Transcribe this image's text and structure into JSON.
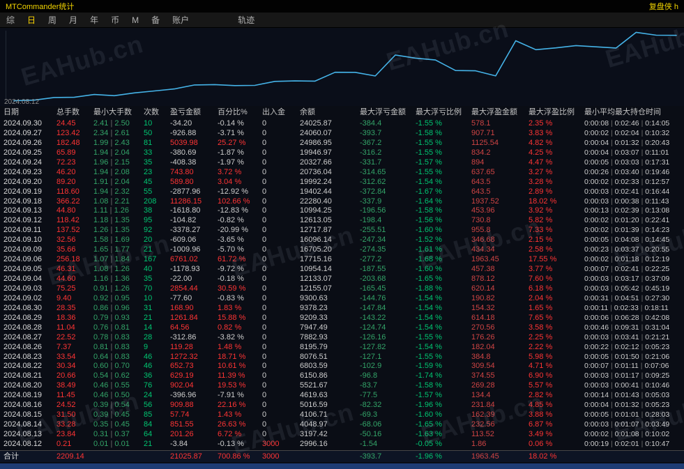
{
  "title_bar": {
    "app_title": "MTCommander统计",
    "right_text": "复盘侠 h"
  },
  "menu": {
    "items": [
      "综",
      "日",
      "周",
      "月",
      "年",
      "币",
      "M",
      "备",
      "账户",
      "轨迹"
    ],
    "active": "日"
  },
  "chart": {
    "label_start_date": "2024.08.12",
    "watermark": "EAHub.cn",
    "line_color": "#45b3e8"
  },
  "chart_data": {
    "type": "line",
    "title": "",
    "xlabel": "",
    "ylabel": "余额",
    "legend": [],
    "grid": false,
    "ylim": [
      2900,
      25300
    ],
    "x": [
      "2024.08.12",
      "2024.08.13",
      "2024.08.14",
      "2024.08.15",
      "2024.08.16",
      "2024.08.19",
      "2024.08.20",
      "2024.08.21",
      "2024.08.22",
      "2024.08.23",
      "2024.08.26",
      "2024.08.27",
      "2024.08.28",
      "2024.08.29",
      "2024.08.30",
      "2024.09.02",
      "2024.09.03",
      "2024.09.04",
      "2024.09.05",
      "2024.09.06",
      "2024.09.09",
      "2024.09.10",
      "2024.09.11",
      "2024.09.12",
      "2024.09.13",
      "2024.09.18",
      "2024.09.19",
      "2024.09.20",
      "2024.09.23",
      "2024.09.24",
      "2024.09.25",
      "2024.09.26",
      "2024.09.27",
      "2024.09.30"
    ],
    "series": [
      {
        "name": "余额",
        "values": [
          2996.16,
          3197.42,
          4048.97,
          4106.71,
          5016.59,
          4619.63,
          5521.67,
          6150.86,
          6803.59,
          8076.51,
          8195.79,
          7882.93,
          7947.49,
          9209.33,
          9378.23,
          9300.63,
          12155.07,
          12133.07,
          10954.14,
          17715.16,
          16705.2,
          16096.14,
          12717.87,
          12613.05,
          10994.25,
          22280.4,
          19402.44,
          19992.24,
          20736.04,
          20327.66,
          19946.97,
          24986.95,
          24060.07,
          24025.87
        ]
      }
    ]
  },
  "table": {
    "headers": [
      "日期",
      "总手数",
      "最小大手数",
      "次数",
      "盈亏金额",
      "百分比%",
      "出入金",
      "余额",
      "最大浮亏金额",
      "最大浮亏比例",
      "最大浮盈金额",
      "最大浮盈比例",
      "最小平均最大持仓时间"
    ],
    "rows": [
      {
        "d": "2024.09.30",
        "lots": "24.45",
        "mn": "2.41",
        "mx": "2.50",
        "n": "10",
        "pl": "-34.20",
        "plp": "-0.14 %",
        "io": "0",
        "bal": "24025.87",
        "mfl": "-384.4",
        "mflp": "-1.55 %",
        "mfp": "578.1",
        "mfpp": "2.35 %",
        "t": [
          "0:00:08",
          "0:02:46",
          "0:14:05"
        ]
      },
      {
        "d": "2024.09.27",
        "lots": "123.42",
        "mn": "2.34",
        "mx": "2.61",
        "n": "50",
        "pl": "-926.88",
        "plp": "-3.71 %",
        "io": "0",
        "bal": "24060.07",
        "mfl": "-393.7",
        "mflp": "-1.58 %",
        "mfp": "907.71",
        "mfpp": "3.83 %",
        "t": [
          "0:00:02",
          "0:02:04",
          "0:10:32"
        ]
      },
      {
        "d": "2024.09.26",
        "lots": "182.48",
        "mn": "1.99",
        "mx": "2.43",
        "n": "81",
        "pl": "5039.98",
        "plp": "25.27 %",
        "io": "0",
        "bal": "24986.95",
        "mfl": "-367.2",
        "mflp": "-1.55 %",
        "mfp": "1125.54",
        "mfpp": "4.82 %",
        "t": [
          "0:00:04",
          "0:01:32",
          "0:20:43"
        ]
      },
      {
        "d": "2024.09.25",
        "lots": "65.89",
        "mn": "1.94",
        "mx": "2.04",
        "n": "33",
        "pl": "-380.69",
        "plp": "-1.87 %",
        "io": "0",
        "bal": "19946.97",
        "mfl": "-316.2",
        "mflp": "-1.55 %",
        "mfp": "834.2",
        "mfpp": "4.25 %",
        "t": [
          "0:00:04",
          "0:03:07",
          "0:11:01"
        ]
      },
      {
        "d": "2024.09.24",
        "lots": "72.23",
        "mn": "1.96",
        "mx": "2.15",
        "n": "35",
        "pl": "-408.38",
        "plp": "-1.97 %",
        "io": "0",
        "bal": "20327.66",
        "mfl": "-331.7",
        "mflp": "-1.57 %",
        "mfp": "894",
        "mfpp": "4.47 %",
        "t": [
          "0:00:05",
          "0:03:03",
          "0:17:31"
        ]
      },
      {
        "d": "2024.09.23",
        "lots": "46.20",
        "mn": "1.94",
        "mx": "2.08",
        "n": "23",
        "pl": "743.80",
        "plp": "3.72 %",
        "io": "0",
        "bal": "20736.04",
        "mfl": "-314.65",
        "mflp": "-1.55 %",
        "mfp": "637.65",
        "mfpp": "3.27 %",
        "t": [
          "0:00:26",
          "0:03:40",
          "0:19:46"
        ]
      },
      {
        "d": "2024.09.20",
        "lots": "89.20",
        "mn": "1.91",
        "mx": "2.04",
        "n": "45",
        "pl": "589.80",
        "plp": "3.04 %",
        "io": "0",
        "bal": "19992.24",
        "mfl": "-312.62",
        "mflp": "-1.54 %",
        "mfp": "643.5",
        "mfpp": "3.28 %",
        "t": [
          "0:00:02",
          "0:02:33",
          "0:12:57"
        ]
      },
      {
        "d": "2024.09.19",
        "lots": "118.60",
        "mn": "1.94",
        "mx": "2.32",
        "n": "55",
        "pl": "-2877.96",
        "plp": "-12.92 %",
        "io": "0",
        "bal": "19402.44",
        "mfl": "-372.84",
        "mflp": "-1.67 %",
        "mfp": "643.5",
        "mfpp": "2.89 %",
        "t": [
          "0:00:03",
          "0:02:41",
          "0:16:44"
        ]
      },
      {
        "d": "2024.09.18",
        "lots": "366.22",
        "mn": "1.08",
        "mx": "2.21",
        "n": "208",
        "pl": "11286.15",
        "plp": "102.66 %",
        "io": "0",
        "bal": "22280.40",
        "mfl": "-337.9",
        "mflp": "-1.64 %",
        "mfp": "1937.52",
        "mfpp": "18.02 %",
        "t": [
          "0:00:03",
          "0:00:38",
          "0:11:43"
        ]
      },
      {
        "d": "2024.09.13",
        "lots": "44.80",
        "mn": "1.11",
        "mx": "1.26",
        "n": "38",
        "pl": "-1618.80",
        "plp": "-12.83 %",
        "io": "0",
        "bal": "10994.25",
        "mfl": "-196.56",
        "mflp": "-1.58 %",
        "mfp": "453.96",
        "mfpp": "3.92 %",
        "t": [
          "0:00:13",
          "0:02:39",
          "0:13:08"
        ]
      },
      {
        "d": "2024.09.12",
        "lots": "118.42",
        "mn": "1.18",
        "mx": "1.35",
        "n": "95",
        "pl": "-104.82",
        "plp": "-0.82 %",
        "io": "0",
        "bal": "12613.05",
        "mfl": "-198.4",
        "mflp": "-1.56 %",
        "mfp": "730.8",
        "mfpp": "5.82 %",
        "t": [
          "0:00:02",
          "0:01:20",
          "0:22:41"
        ]
      },
      {
        "d": "2024.09.11",
        "lots": "137.52",
        "mn": "1.26",
        "mx": "1.35",
        "n": "92",
        "pl": "-3378.27",
        "plp": "-20.99 %",
        "io": "0",
        "bal": "12717.87",
        "mfl": "-255.51",
        "mflp": "-1.60 %",
        "mfp": "955.8",
        "mfpp": "7.33 %",
        "t": [
          "0:00:02",
          "0:01:39",
          "0:14:23"
        ]
      },
      {
        "d": "2024.09.10",
        "lots": "32.56",
        "mn": "1.58",
        "mx": "1.69",
        "n": "20",
        "pl": "-609.06",
        "plp": "-3.65 %",
        "io": "0",
        "bal": "16096.14",
        "mfl": "-247.34",
        "mflp": "-1.52 %",
        "mfp": "346.68",
        "mfpp": "2.15 %",
        "t": [
          "0:00:05",
          "0:04:08",
          "0:14:45"
        ]
      },
      {
        "d": "2024.09.09",
        "lots": "35.66",
        "mn": "1.65",
        "mx": "1.77",
        "n": "21",
        "pl": "-1009.96",
        "plp": "-5.70 %",
        "io": "0",
        "bal": "16705.20",
        "mfl": "-274.35",
        "mflp": "-1.61 %",
        "mfp": "434.34",
        "mfpp": "2.58 %",
        "t": [
          "0:00:23",
          "0:03:37",
          "0:20:55"
        ]
      },
      {
        "d": "2024.09.06",
        "lots": "256.18",
        "mn": "1.07",
        "mx": "1.84",
        "n": "167",
        "pl": "6761.02",
        "plp": "61.72 %",
        "io": "0",
        "bal": "17715.16",
        "mfl": "-277.2",
        "mflp": "-1.68 %",
        "mfp": "1963.45",
        "mfpp": "17.55 %",
        "t": [
          "0:00:02",
          "0:01:18",
          "0:12:19"
        ]
      },
      {
        "d": "2024.09.05",
        "lots": "46.31",
        "mn": "1.08",
        "mx": "1.26",
        "n": "40",
        "pl": "-1178.93",
        "plp": "-9.72 %",
        "io": "0",
        "bal": "10954.14",
        "mfl": "-187.55",
        "mflp": "-1.60 %",
        "mfp": "457.38",
        "mfpp": "3.77 %",
        "t": [
          "0:00:07",
          "0:02:41",
          "0:22:25"
        ]
      },
      {
        "d": "2024.09.04",
        "lots": "44.60",
        "mn": "1.16",
        "mx": "1.36",
        "n": "35",
        "pl": "-22.00",
        "plp": "-0.18 %",
        "io": "0",
        "bal": "12133.07",
        "mfl": "-203.68",
        "mflp": "-1.65 %",
        "mfp": "878.12",
        "mfpp": "7.60 %",
        "t": [
          "0:00:03",
          "0:03:17",
          "0:37:09"
        ]
      },
      {
        "d": "2024.09.03",
        "lots": "75.25",
        "mn": "0.91",
        "mx": "1.26",
        "n": "70",
        "pl": "2854.44",
        "plp": "30.59 %",
        "io": "0",
        "bal": "12155.07",
        "mfl": "-165.45",
        "mflp": "-1.88 %",
        "mfp": "620.14",
        "mfpp": "6.18 %",
        "t": [
          "0:00:03",
          "0:05:42",
          "0:45:19"
        ]
      },
      {
        "d": "2024.09.02",
        "lots": "9.40",
        "mn": "0.92",
        "mx": "0.95",
        "n": "10",
        "pl": "-77.60",
        "plp": "-0.83 %",
        "io": "0",
        "bal": "9300.63",
        "mfl": "-144.76",
        "mflp": "-1.54 %",
        "mfp": "190.82",
        "mfpp": "2.04 %",
        "t": [
          "0:00:31",
          "0:04:51",
          "0:27:30"
        ]
      },
      {
        "d": "2024.08.30",
        "lots": "28.35",
        "mn": "0.86",
        "mx": "0.96",
        "n": "31",
        "pl": "168.90",
        "plp": "1.83 %",
        "io": "0",
        "bal": "9378.23",
        "mfl": "-147.84",
        "mflp": "-1.54 %",
        "mfp": "154.32",
        "mfpp": "1.65 %",
        "t": [
          "0:00:11",
          "0:02:33",
          "0:18:11"
        ]
      },
      {
        "d": "2024.08.29",
        "lots": "18.36",
        "mn": "0.79",
        "mx": "0.93",
        "n": "21",
        "pl": "1261.84",
        "plp": "15.88 %",
        "io": "0",
        "bal": "9209.33",
        "mfl": "-143.22",
        "mflp": "-1.54 %",
        "mfp": "614.18",
        "mfpp": "7.65 %",
        "t": [
          "0:00:06",
          "0:06:28",
          "0:42:08"
        ]
      },
      {
        "d": "2024.08.28",
        "lots": "11.04",
        "mn": "0.76",
        "mx": "0.81",
        "n": "14",
        "pl": "64.56",
        "plp": "0.82 %",
        "io": "0",
        "bal": "7947.49",
        "mfl": "-124.74",
        "mflp": "-1.54 %",
        "mfp": "270.56",
        "mfpp": "3.58 %",
        "t": [
          "0:00:46",
          "0:09:31",
          "0:31:04"
        ]
      },
      {
        "d": "2024.08.27",
        "lots": "22.52",
        "mn": "0.78",
        "mx": "0.83",
        "n": "28",
        "pl": "-312.86",
        "plp": "-3.82 %",
        "io": "0",
        "bal": "7882.93",
        "mfl": "-126.16",
        "mflp": "-1.55 %",
        "mfp": "176.26",
        "mfpp": "2.25 %",
        "t": [
          "0:00:03",
          "0:03:41",
          "0:21:21"
        ]
      },
      {
        "d": "2024.08.26",
        "lots": "7.37",
        "mn": "0.81",
        "mx": "0.83",
        "n": "9",
        "pl": "119.28",
        "plp": "1.48 %",
        "io": "0",
        "bal": "8195.79",
        "mfl": "-127.82",
        "mflp": "-1.54 %",
        "mfp": "182.04",
        "mfpp": "2.22 %",
        "t": [
          "0:00:22",
          "0:02:12",
          "0:05:23"
        ]
      },
      {
        "d": "2024.08.23",
        "lots": "33.54",
        "mn": "0.64",
        "mx": "0.83",
        "n": "46",
        "pl": "1272.32",
        "plp": "18.71 %",
        "io": "0",
        "bal": "8076.51",
        "mfl": "-127.1",
        "mflp": "-1.55 %",
        "mfp": "384.8",
        "mfpp": "5.98 %",
        "t": [
          "0:00:05",
          "0:01:50",
          "0:21:06"
        ]
      },
      {
        "d": "2024.08.22",
        "lots": "30.34",
        "mn": "0.60",
        "mx": "0.70",
        "n": "46",
        "pl": "652.73",
        "plp": "10.61 %",
        "io": "0",
        "bal": "6803.59",
        "mfl": "-102.9",
        "mflp": "-1.59 %",
        "mfp": "309.54",
        "mfpp": "4.71 %",
        "t": [
          "0:00:07",
          "0:01:11",
          "0:07:06"
        ]
      },
      {
        "d": "2024.08.21",
        "lots": "20.66",
        "mn": "0.54",
        "mx": "0.62",
        "n": "36",
        "pl": "629.19",
        "plp": "11.39 %",
        "io": "0",
        "bal": "6150.86",
        "mfl": "-96.8",
        "mflp": "-1.74 %",
        "mfp": "374.55",
        "mfpp": "6.90 %",
        "t": [
          "0:00:03",
          "0:01:17",
          "0:09:25"
        ]
      },
      {
        "d": "2024.08.20",
        "lots": "38.49",
        "mn": "0.46",
        "mx": "0.55",
        "n": "76",
        "pl": "902.04",
        "plp": "19.53 %",
        "io": "0",
        "bal": "5521.67",
        "mfl": "-83.7",
        "mflp": "-1.58 %",
        "mfp": "269.28",
        "mfpp": "5.57 %",
        "t": [
          "0:00:03",
          "0:00:41",
          "0:10:46"
        ]
      },
      {
        "d": "2024.08.19",
        "lots": "11.45",
        "mn": "0.46",
        "mx": "0.50",
        "n": "24",
        "pl": "-396.96",
        "plp": "-7.91 %",
        "io": "0",
        "bal": "4619.63",
        "mfl": "-77.5",
        "mflp": "-1.57 %",
        "mfp": "134.4",
        "mfpp": "2.82 %",
        "t": [
          "0:00:14",
          "0:01:43",
          "0:05:03"
        ]
      },
      {
        "d": "2024.08.16",
        "lots": "24.52",
        "mn": "0.39",
        "mx": "0.54",
        "n": "56",
        "pl": "909.88",
        "plp": "22.16 %",
        "io": "0",
        "bal": "5016.59",
        "mfl": "-82.32",
        "mflp": "-1.96 %",
        "mfp": "231.84",
        "mfpp": "4.85 %",
        "t": [
          "0:00:04",
          "0:01:32",
          "0:05:23"
        ]
      },
      {
        "d": "2024.08.15",
        "lots": "31.50",
        "mn": "0.39",
        "mx": "0.45",
        "n": "85",
        "pl": "57.74",
        "plp": "1.43 %",
        "io": "0",
        "bal": "4106.71",
        "mfl": "-69.3",
        "mflp": "-1.60 %",
        "mfp": "162.39",
        "mfpp": "3.88 %",
        "t": [
          "0:00:05",
          "0:01:01",
          "0:28:03"
        ]
      },
      {
        "d": "2024.08.14",
        "lots": "33.28",
        "mn": "0.35",
        "mx": "0.45",
        "n": "84",
        "pl": "851.55",
        "plp": "26.63 %",
        "io": "0",
        "bal": "4048.97",
        "mfl": "-68.06",
        "mflp": "-1.65 %",
        "mfp": "232.56",
        "mfpp": "6.87 %",
        "t": [
          "0:00:03",
          "0:01:07",
          "0:03:49"
        ]
      },
      {
        "d": "2024.08.13",
        "lots": "23.84",
        "mn": "0.31",
        "mx": "0.37",
        "n": "64",
        "pl": "201.26",
        "plp": "6.72 %",
        "io": "0",
        "bal": "3197.42",
        "mfl": "-50.16",
        "mflp": "-1.63 %",
        "mfp": "113.52",
        "mfpp": "3.49 %",
        "t": [
          "0:00:02",
          "0:01:08",
          "0:10:02"
        ]
      },
      {
        "d": "2024.08.12",
        "lots": "0.21",
        "mn": "0.01",
        "mx": "0.01",
        "n": "21",
        "pl": "-3.84",
        "plp": "-0.13 %",
        "io": "3000",
        "bal": "2996.16",
        "mfl": "-1.54",
        "mflp": "-0.05 %",
        "mfp": "1.86",
        "mfpp": "0.06 %",
        "t": [
          "0:00:19",
          "0:02:01",
          "0:10:47"
        ]
      }
    ],
    "total": {
      "label": "合计",
      "lots": "2209.14",
      "pl": "21025.87",
      "plp": "700.86 %",
      "io": "3000",
      "mfl": "-393.7",
      "mflp": "-1.96 %",
      "mfp": "1963.45",
      "mfpp": "18.02 %"
    }
  }
}
